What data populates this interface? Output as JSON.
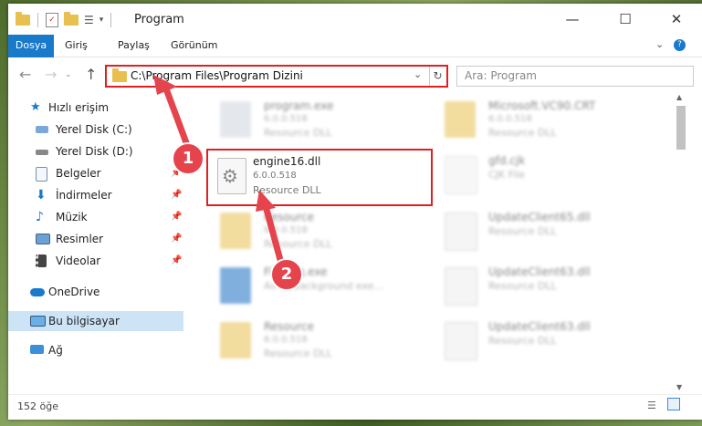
{
  "window": {
    "title": "Program"
  },
  "ribbon": {
    "tabs": [
      "Dosya",
      "Giriş",
      "Paylaş",
      "Görünüm"
    ]
  },
  "address": {
    "path": "C:\\Program Files\\Program Dizini"
  },
  "search": {
    "placeholder": "Ara: Program"
  },
  "sidebar": {
    "items": [
      {
        "label": "Hızlı erişim",
        "pinned": false
      },
      {
        "label": "Yerel Disk (C:)",
        "pinned": false
      },
      {
        "label": "Yerel Disk (D:)",
        "pinned": false
      },
      {
        "label": "Belgeler",
        "pinned": true
      },
      {
        "label": "İndirmeler",
        "pinned": true
      },
      {
        "label": "Müzik",
        "pinned": true
      },
      {
        "label": "Resimler",
        "pinned": true
      },
      {
        "label": "Videolar",
        "pinned": true
      },
      {
        "label": "OneDrive",
        "pinned": false
      },
      {
        "label": "Bu bilgisayar",
        "pinned": false
      },
      {
        "label": "Ağ",
        "pinned": false
      }
    ]
  },
  "files": [
    {
      "name": "program.exe",
      "version": "6.0.0.518",
      "type": "Resource DLL"
    },
    {
      "name": "Microsoft.VC90.CRT",
      "version": "6.0.0.518",
      "type": "Resource DLL"
    },
    {
      "name": "engine16.dll",
      "version": "6.0.0.518",
      "type": "Resource DLL"
    },
    {
      "name": "gfd.cjk",
      "version": "",
      "type": "CJK File"
    },
    {
      "name": "Resource",
      "version": "6.0.0.518",
      "type": "Resource DLL"
    },
    {
      "name": "UpdateClient65.dll",
      "version": "",
      "type": "Resource DLL"
    },
    {
      "name": "Firebug.exe",
      "version": "",
      "type": "Aimp Background exe..."
    },
    {
      "name": "UpdateClient63.dll",
      "version": "",
      "type": "Resource DLL"
    },
    {
      "name": "Resource",
      "version": "6.0.0.518",
      "type": "Resource DLL"
    },
    {
      "name": "UpdateClient63.dll",
      "version": "",
      "type": "Resource DLL"
    }
  ],
  "status": {
    "count": "152 öğe"
  },
  "callouts": {
    "one": "1",
    "two": "2"
  },
  "colors": {
    "accent": "#1979ca",
    "highlight": "#e02020",
    "callout": "#e5444d"
  }
}
